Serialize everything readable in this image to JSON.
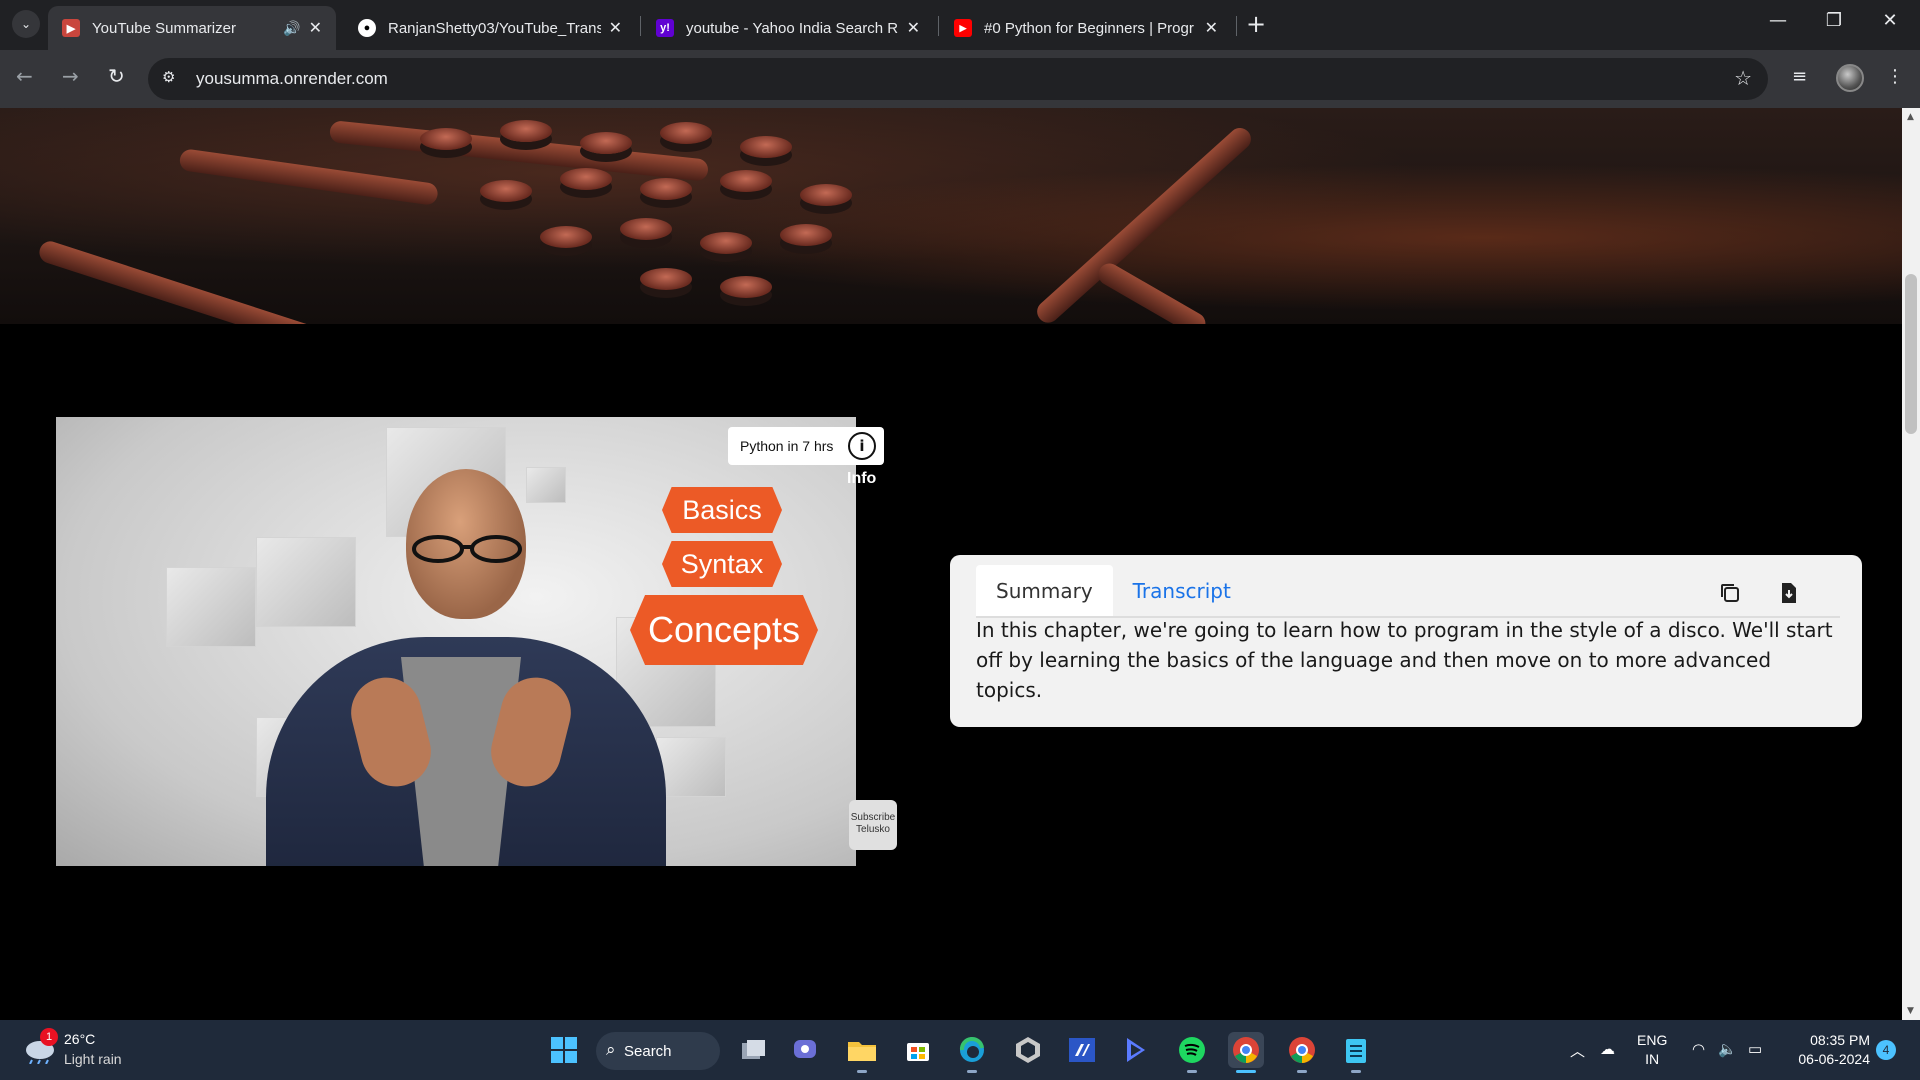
{
  "browser": {
    "tabs": [
      {
        "title": "YouTube Summarizer",
        "active": true,
        "audio": true
      },
      {
        "title": "RanjanShetty03/YouTube_Trans",
        "active": false
      },
      {
        "title": "youtube - Yahoo India Search R",
        "active": false
      },
      {
        "title": "#0 Python for Beginners | Progr",
        "active": false
      }
    ],
    "url": "yousumma.onrender.com"
  },
  "video": {
    "tags": [
      "Basics",
      "Syntax",
      "Concepts"
    ],
    "info_title": "Python in 7 hrs",
    "info_label": "Info",
    "subscribe_label": "Subscribe",
    "channel": "Telusko"
  },
  "panel": {
    "tabs": [
      "Summary",
      "Transcript"
    ],
    "active_tab": "Summary",
    "text": "In this chapter, we're going to learn how to program in the style of a disco. We'll start off by learning the basics of the language and then move on to more advanced topics."
  },
  "taskbar": {
    "weather": {
      "temp": "26°C",
      "desc": "Light rain",
      "badge": "1"
    },
    "search_label": "Search",
    "lang": [
      "ENG",
      "IN"
    ],
    "time": "08:35 PM",
    "date": "06-06-2024",
    "notifications": "4"
  },
  "colors": {
    "accent_orange": "#ec5a26",
    "link_blue": "#1a73e8",
    "chrome_dark": "#202124",
    "taskbar": "#1f2a3a"
  }
}
